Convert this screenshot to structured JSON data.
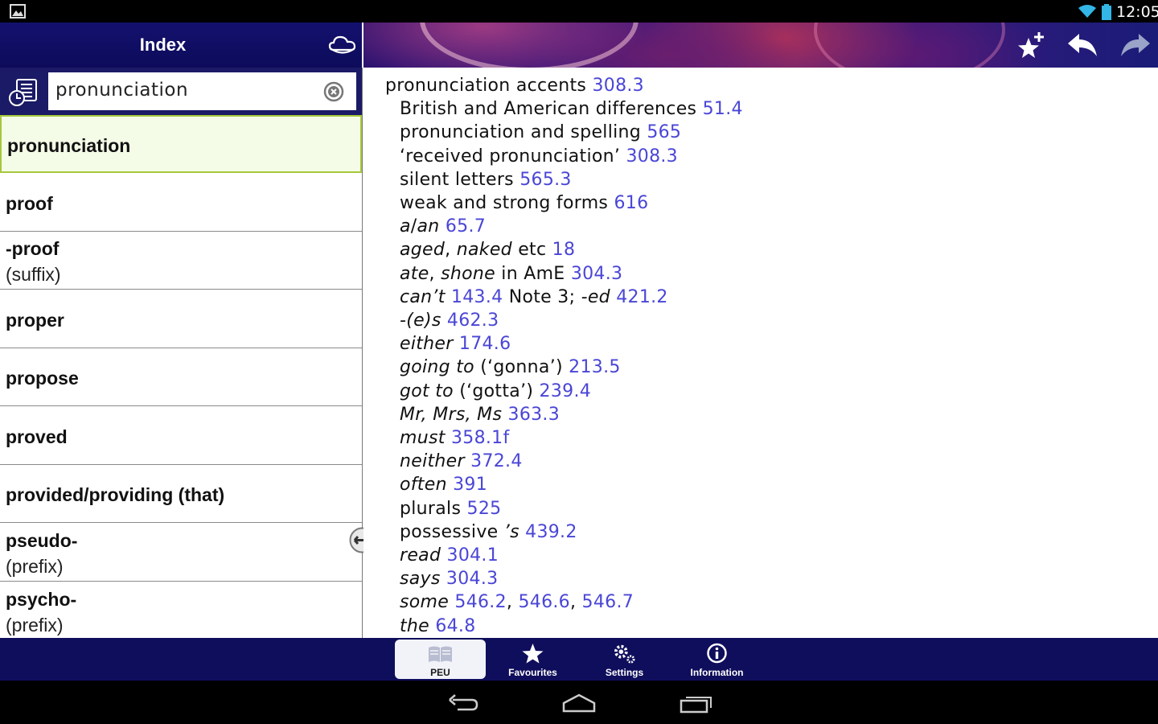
{
  "status_bar": {
    "time": "12:05"
  },
  "left_header": {
    "title": "Index"
  },
  "search": {
    "value": "pronunciation"
  },
  "index_items": [
    {
      "term": "pronunciation",
      "sub": ""
    },
    {
      "term": "proof",
      "sub": ""
    },
    {
      "term": "-proof",
      "sub": "(suffix)"
    },
    {
      "term": "proper",
      "sub": ""
    },
    {
      "term": "propose",
      "sub": ""
    },
    {
      "term": "proved",
      "sub": ""
    },
    {
      "term": "provided/providing (that)",
      "sub": ""
    },
    {
      "term": "pseudo-",
      "sub": "(prefix)"
    },
    {
      "term": "psycho-",
      "sub": "(prefix)"
    }
  ],
  "content": {
    "headword": "pronunciation",
    "lines": [
      {
        "parts": [
          {
            "t": "accents ",
            "s": "n"
          },
          {
            "t": "308.3",
            "s": "r"
          }
        ]
      },
      {
        "parts": [
          {
            "t": "British and American differences ",
            "s": "n"
          },
          {
            "t": "51.4",
            "s": "r"
          }
        ]
      },
      {
        "parts": [
          {
            "t": "pronunciation and spelling ",
            "s": "n"
          },
          {
            "t": "565",
            "s": "r"
          }
        ]
      },
      {
        "parts": [
          {
            "t": "‘received pronunciation’ ",
            "s": "n"
          },
          {
            "t": "308.3",
            "s": "r"
          }
        ]
      },
      {
        "parts": [
          {
            "t": "silent letters ",
            "s": "n"
          },
          {
            "t": "565.3",
            "s": "r"
          }
        ]
      },
      {
        "parts": [
          {
            "t": "weak and strong forms ",
            "s": "n"
          },
          {
            "t": "616",
            "s": "r"
          }
        ]
      },
      {
        "parts": [
          {
            "t": "a",
            "s": "i"
          },
          {
            "t": "/",
            "s": "n"
          },
          {
            "t": "an",
            "s": "i"
          },
          {
            "t": " ",
            "s": "n"
          },
          {
            "t": "65.7",
            "s": "r"
          }
        ]
      },
      {
        "parts": [
          {
            "t": "aged",
            "s": "i"
          },
          {
            "t": ", ",
            "s": "n"
          },
          {
            "t": "naked",
            "s": "i"
          },
          {
            "t": " etc ",
            "s": "n"
          },
          {
            "t": "18",
            "s": "r"
          }
        ]
      },
      {
        "parts": [
          {
            "t": "ate",
            "s": "i"
          },
          {
            "t": ", ",
            "s": "n"
          },
          {
            "t": "shone",
            "s": "i"
          },
          {
            "t": " in AmE ",
            "s": "n"
          },
          {
            "t": "304.3",
            "s": "r"
          }
        ]
      },
      {
        "parts": [
          {
            "t": "can’t",
            "s": "i"
          },
          {
            "t": " ",
            "s": "n"
          },
          {
            "t": "143.4",
            "s": "r"
          },
          {
            "t": " Note 3; ",
            "s": "n"
          },
          {
            "t": "-ed",
            "s": "i"
          },
          {
            "t": " ",
            "s": "n"
          },
          {
            "t": "421.2",
            "s": "r"
          }
        ]
      },
      {
        "parts": [
          {
            "t": "-(e)s",
            "s": "i"
          },
          {
            "t": " ",
            "s": "n"
          },
          {
            "t": "462.3",
            "s": "r"
          }
        ]
      },
      {
        "parts": [
          {
            "t": "either",
            "s": "i"
          },
          {
            "t": " ",
            "s": "n"
          },
          {
            "t": "174.6",
            "s": "r"
          }
        ]
      },
      {
        "parts": [
          {
            "t": "going to",
            "s": "i"
          },
          {
            "t": " (‘gonna’) ",
            "s": "n"
          },
          {
            "t": "213.5",
            "s": "r"
          }
        ]
      },
      {
        "parts": [
          {
            "t": "got to",
            "s": "i"
          },
          {
            "t": " (‘gotta’) ",
            "s": "n"
          },
          {
            "t": "239.4",
            "s": "r"
          }
        ]
      },
      {
        "parts": [
          {
            "t": "Mr, Mrs, Ms",
            "s": "i"
          },
          {
            "t": " ",
            "s": "n"
          },
          {
            "t": "363.3",
            "s": "r"
          }
        ]
      },
      {
        "parts": [
          {
            "t": "must",
            "s": "i"
          },
          {
            "t": " ",
            "s": "n"
          },
          {
            "t": "358.1f",
            "s": "r"
          }
        ]
      },
      {
        "parts": [
          {
            "t": "neither",
            "s": "i"
          },
          {
            "t": " ",
            "s": "n"
          },
          {
            "t": "372.4",
            "s": "r"
          }
        ]
      },
      {
        "parts": [
          {
            "t": "often",
            "s": "i"
          },
          {
            "t": " ",
            "s": "n"
          },
          {
            "t": "391",
            "s": "r"
          }
        ]
      },
      {
        "parts": [
          {
            "t": "plurals ",
            "s": "n"
          },
          {
            "t": "525",
            "s": "r"
          }
        ]
      },
      {
        "parts": [
          {
            "t": "possessive  ",
            "s": "n"
          },
          {
            "t": "’s",
            "s": "i"
          },
          {
            "t": " ",
            "s": "n"
          },
          {
            "t": "439.2",
            "s": "r"
          }
        ]
      },
      {
        "parts": [
          {
            "t": "read",
            "s": "i"
          },
          {
            "t": " ",
            "s": "n"
          },
          {
            "t": "304.1",
            "s": "r"
          }
        ]
      },
      {
        "parts": [
          {
            "t": "says",
            "s": "i"
          },
          {
            "t": " ",
            "s": "n"
          },
          {
            "t": "304.3",
            "s": "r"
          }
        ]
      },
      {
        "parts": [
          {
            "t": "some",
            "s": "i"
          },
          {
            "t": " ",
            "s": "n"
          },
          {
            "t": "546.2",
            "s": "r"
          },
          {
            "t": ", ",
            "s": "n"
          },
          {
            "t": "546.6",
            "s": "r"
          },
          {
            "t": ", ",
            "s": "n"
          },
          {
            "t": "546.7",
            "s": "r"
          }
        ]
      },
      {
        "parts": [
          {
            "t": "the",
            "s": "i"
          },
          {
            "t": " ",
            "s": "n"
          },
          {
            "t": "64.8",
            "s": "r"
          }
        ]
      }
    ]
  },
  "bottom_nav": [
    {
      "label": "PEU",
      "icon": "book-icon",
      "active": true
    },
    {
      "label": "Favourites",
      "icon": "star-icon",
      "active": false
    },
    {
      "label": "Settings",
      "icon": "gears-icon",
      "active": false
    },
    {
      "label": "Information",
      "icon": "info-icon",
      "active": false
    }
  ],
  "colors": {
    "header_navy": "#13116e",
    "reference_link": "#4a46d6",
    "selected_bg": "#f4fbe6",
    "selected_border": "#a6c83c"
  }
}
